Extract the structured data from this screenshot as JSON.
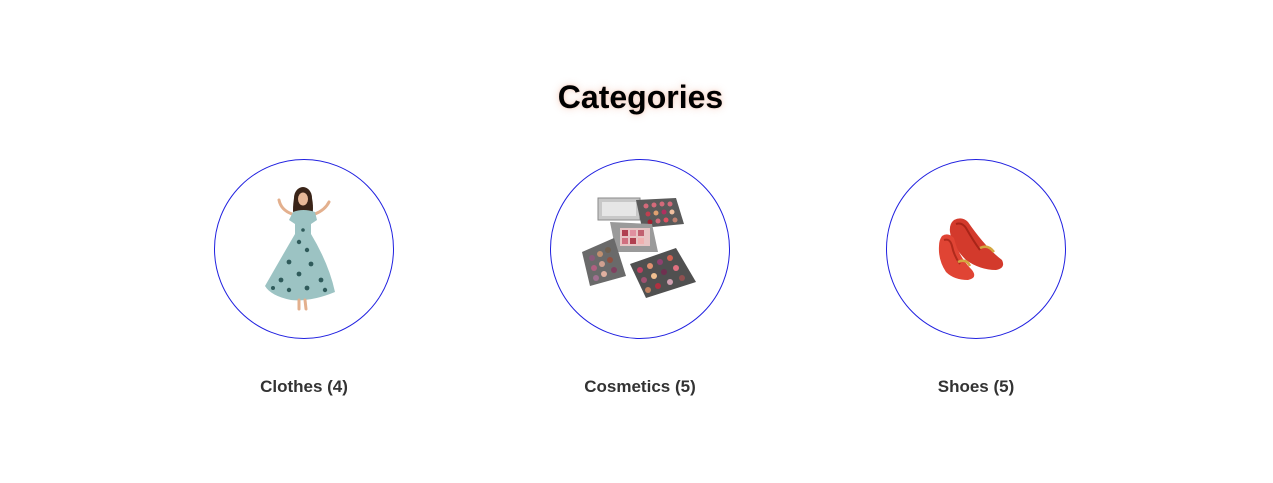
{
  "section": {
    "title": "Categories"
  },
  "categories": [
    {
      "label": "Clothes (4)",
      "icon": "dress-image-icon"
    },
    {
      "label": "Cosmetics (5)",
      "icon": "makeup-palette-image-icon"
    },
    {
      "label": "Shoes (5)",
      "icon": "red-flat-shoes-image-icon"
    }
  ],
  "colors": {
    "circle_border": "#2020e0",
    "label_text": "#333333",
    "heading_text": "#000000",
    "heading_glow": "#e89678"
  }
}
